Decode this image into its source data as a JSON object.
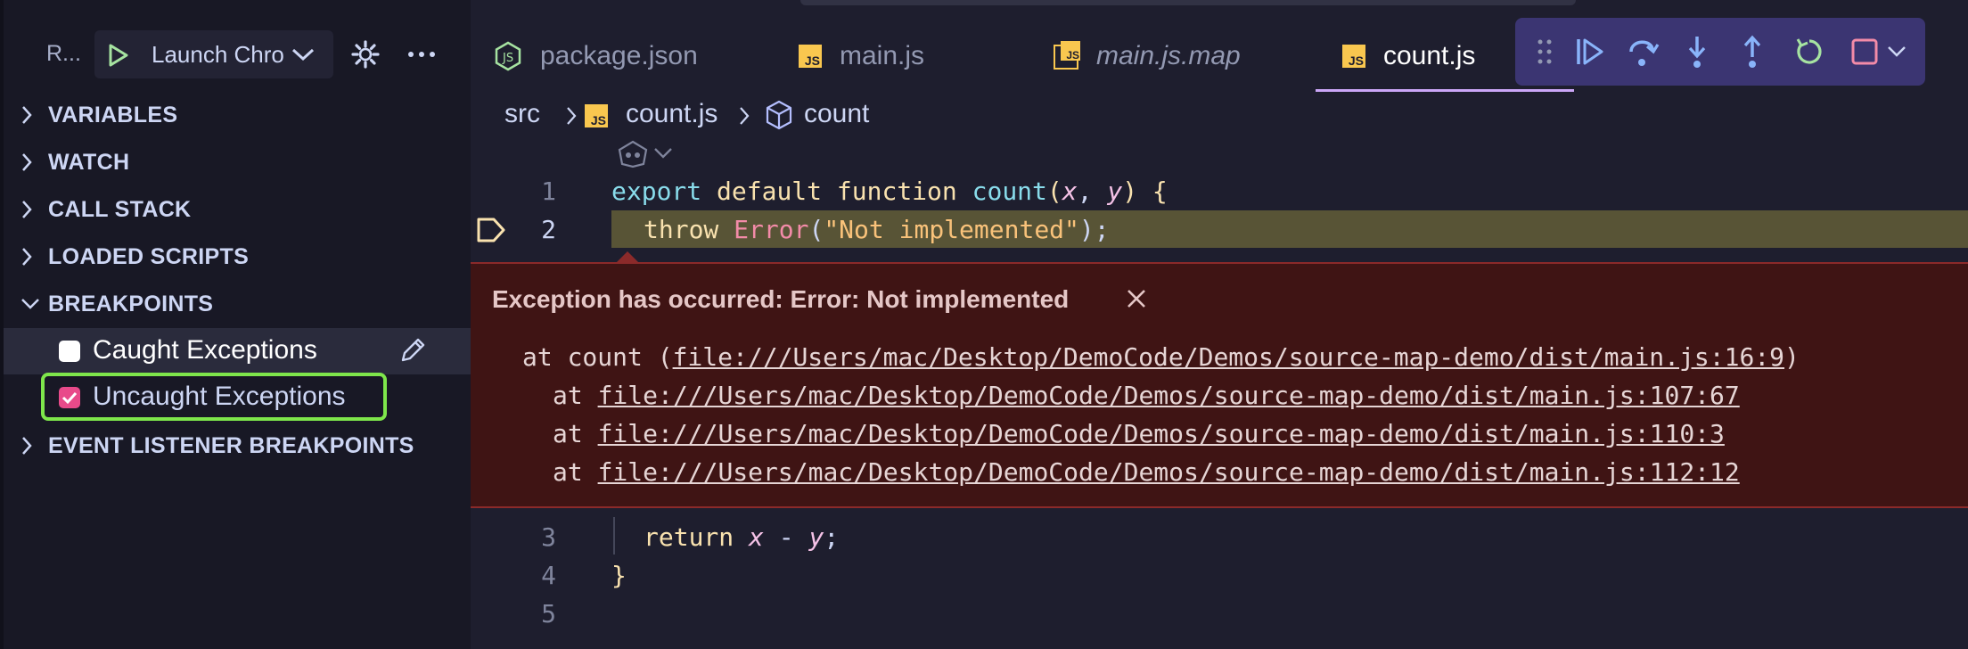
{
  "sidebar": {
    "title": "R...",
    "launch_config": "Launch Chrome",
    "sections": {
      "variables": "VARIABLES",
      "watch": "WATCH",
      "call_stack": "CALL STACK",
      "loaded_scripts": "LOADED SCRIPTS",
      "breakpoints": "BREAKPOINTS",
      "event_listener_breakpoints": "EVENT LISTENER BREAKPOINTS"
    },
    "breakpoints": {
      "caught": {
        "label": "Caught Exceptions",
        "checked": false
      },
      "uncaught": {
        "label": "Uncaught Exceptions",
        "checked": true
      }
    }
  },
  "tabs": [
    {
      "label": "package.json",
      "icon": "nodejs-icon"
    },
    {
      "label": "main.js",
      "icon": "js-file-icon"
    },
    {
      "label": "main.js.map",
      "icon": "js-map-file-icon"
    },
    {
      "label": "count.js",
      "icon": "js-file-icon",
      "active": true
    }
  ],
  "breadcrumb": {
    "folder": "src",
    "file": "count.js",
    "symbol": "count"
  },
  "editor": {
    "line_numbers": [
      "1",
      "2",
      "3",
      "4",
      "5"
    ],
    "exception": {
      "title": "Exception has occurred: Error: Not implemented",
      "stack": {
        "line1_prefix": "at count (",
        "line1_link": "file:///Users/mac/Desktop/DemoCode/Demos/source-map-demo/dist/main.js:16:9",
        "line1_suffix": ")",
        "at": "at",
        "line2_link": "file:///Users/mac/Desktop/DemoCode/Demos/source-map-demo/dist/main.js:107:67",
        "line3_link": "file:///Users/mac/Desktop/DemoCode/Demos/source-map-demo/dist/main.js:110:3",
        "line4_link": "file:///Users/mac/Desktop/DemoCode/Demos/source-map-demo/dist/main.js:112:12"
      }
    }
  },
  "colors": {
    "keyword": "#f9e2af",
    "function": "#89dceb",
    "param": "#f5c2e7",
    "string": "#f9c27a",
    "error_class": "#f38ba8",
    "accent": "#cba6f7",
    "debug_icon": "#89b4fa"
  }
}
